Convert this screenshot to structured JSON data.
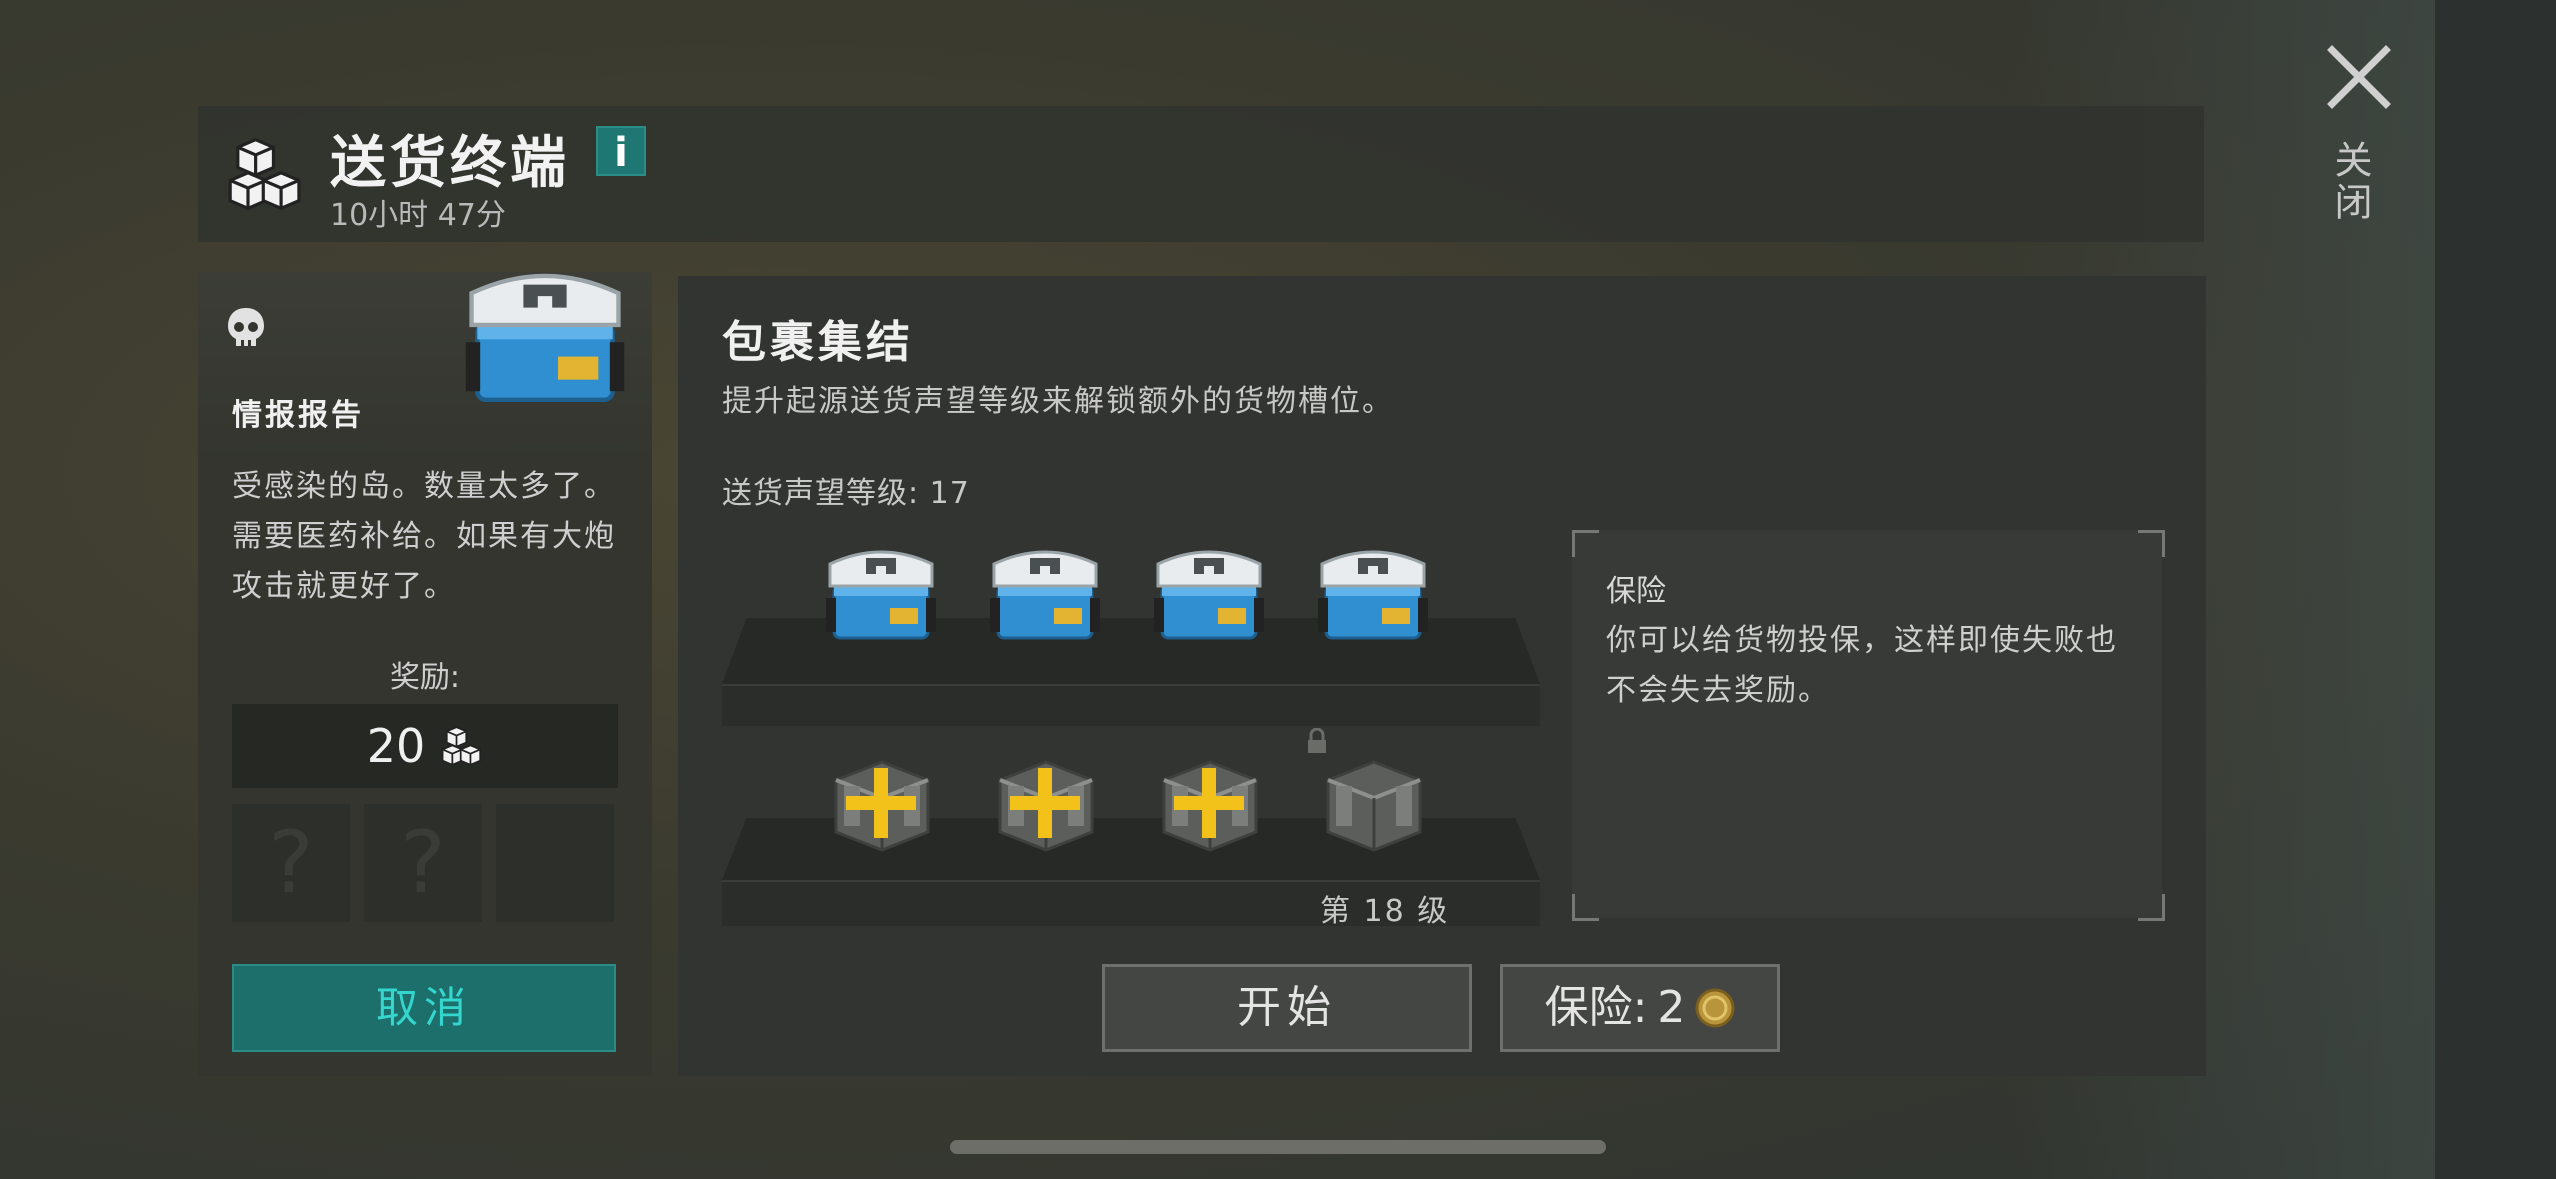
{
  "header": {
    "title": "送货终端",
    "info_label": "i",
    "timer": "10小时 47分",
    "close_label": "关闭"
  },
  "report": {
    "title": "情报报告",
    "text": "受感染的岛。数量太多了。需要医药补给。如果有大炮攻击就更好了。",
    "reward_label": "奖励:",
    "reward_value": "20",
    "mystery_slots": [
      "?",
      "?"
    ],
    "cancel_label": "取消"
  },
  "main": {
    "title": "包裹集结",
    "subtitle": "提升起源送货声望等级来解锁额外的货物槽位。",
    "reputation_label": "送货声望等级: 17",
    "locked_tier_label": "第 18 级"
  },
  "insurance": {
    "title": "保险",
    "text": "你可以给货物投保，这样即使失败也不会失去奖励。",
    "button_label": "保险:",
    "cost": "2"
  },
  "actions": {
    "start_label": "开始"
  },
  "colors": {
    "accent_teal": "#1d6f6b",
    "teal_text": "#34d6cd",
    "plus_yellow": "#f2c21a",
    "cooler_blue": "#2f8fd1"
  }
}
